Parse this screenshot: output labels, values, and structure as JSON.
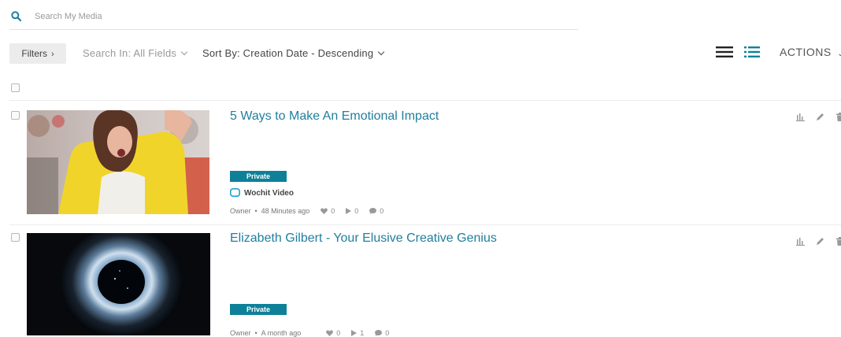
{
  "search": {
    "placeholder": "Search My Media",
    "value": ""
  },
  "toolbar": {
    "filters_label": "Filters",
    "search_in_label": "Search In: All Fields",
    "sort_by_label": "Sort By: Creation Date - Descending",
    "actions_label": "ACTIONS"
  },
  "colors": {
    "accent": "#0e8199",
    "title": "#1f7f9e"
  },
  "items": [
    {
      "title": "5 Ways to Make An Emotional Impact",
      "badge": "Private",
      "channel": "Wochit Video",
      "owner": "Owner",
      "time": "48 Minutes ago",
      "likes": "0",
      "plays": "0",
      "comments": "0"
    },
    {
      "title": "Elizabeth Gilbert - Your Elusive Creative Genius",
      "badge": "Private",
      "owner": "Owner",
      "time": "A month ago",
      "likes": "0",
      "plays": "1",
      "comments": "0"
    }
  ]
}
